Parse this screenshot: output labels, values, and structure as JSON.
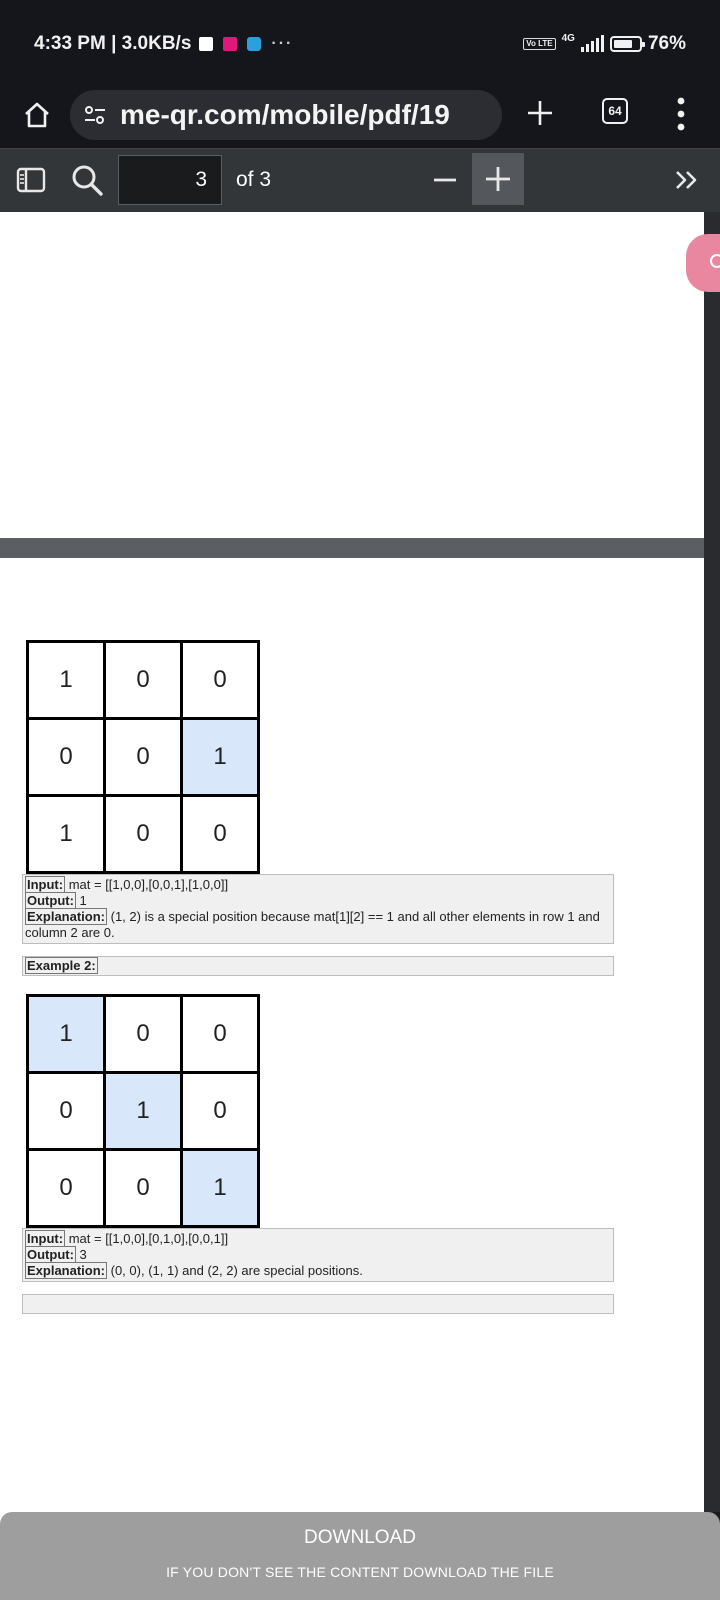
{
  "status_bar": {
    "time_speed": "4:33 PM | 3.0KB/s",
    "more_dots": "···",
    "volte": "Vo LTE",
    "network": "4G",
    "battery_pct": "76%",
    "battery_level": 0.76
  },
  "url_bar": {
    "url": "me-qr.com/mobile/pdf/19",
    "tab_count": "64"
  },
  "pdf_toolbar": {
    "current_page": "3",
    "page_total": "of 3"
  },
  "example1": {
    "matrix": [
      [
        "1",
        "0",
        "0"
      ],
      [
        "0",
        "0",
        "1"
      ],
      [
        "1",
        "0",
        "0"
      ]
    ],
    "input_key": "Input:",
    "input_val": " mat = [[1,0,0],[0,0,1],[1,0,0]]",
    "output_key": "Output:",
    "output_val": " 1",
    "explanation_key": "Explanation:",
    "explanation_val": " (1, 2) is a special position because mat[1][2] == 1 and all other elements in row 1 and column 2 are 0."
  },
  "example2": {
    "heading": "Example 2:",
    "matrix": [
      [
        "1",
        "0",
        "0"
      ],
      [
        "0",
        "1",
        "0"
      ],
      [
        "0",
        "0",
        "1"
      ]
    ],
    "input_key": "Input:",
    "input_val": " mat = [[1,0,0],[0,1,0],[0,0,1]]",
    "output_key": "Output:",
    "output_val": " 3",
    "explanation_key": "Explanation:",
    "explanation_val": " (0, 0), (1, 1) and (2, 2) are special positions."
  },
  "download_banner": {
    "title": "DOWNLOAD",
    "subtitle": "IF YOU DON'T SEE THE CONTENT DOWNLOAD THE FILE"
  }
}
